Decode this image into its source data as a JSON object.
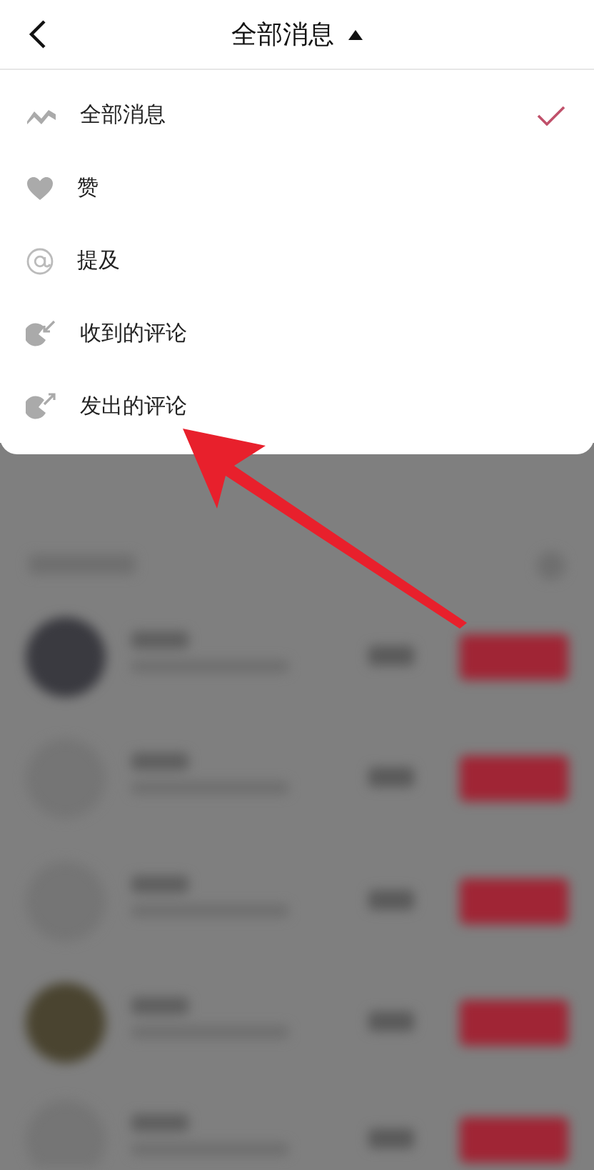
{
  "header": {
    "title": "全部消息"
  },
  "menu": [
    {
      "kind": "all",
      "label": "全部消息",
      "selected": true
    },
    {
      "kind": "like",
      "label": "赞",
      "selected": false
    },
    {
      "kind": "mention",
      "label": "提及",
      "selected": false
    },
    {
      "kind": "received",
      "label": "收到的评论",
      "selected": false
    },
    {
      "kind": "sent",
      "label": "发出的评论",
      "selected": false
    }
  ]
}
